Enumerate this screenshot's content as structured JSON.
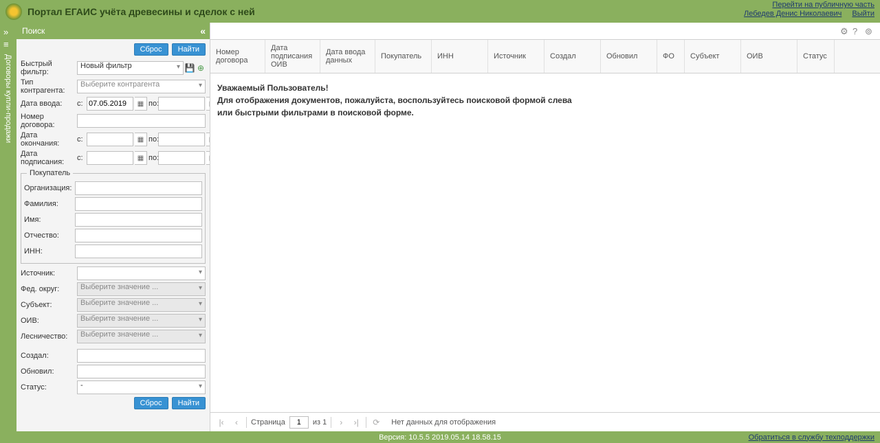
{
  "header": {
    "title": "Портал ЕГАИС учёта древесины и сделок с ней",
    "public_link": "Перейти на публичную часть",
    "user": "Лебедев Денис Николаевич",
    "logout": "Выйти"
  },
  "vtab": {
    "expand": "»",
    "icon": "≡",
    "label": "Договоры купли-продажи"
  },
  "sidebar": {
    "title": "Поиск",
    "collapse": "«",
    "reset": "Сброс",
    "find": "Найти",
    "quick_filter_label": "Быстрый фильтр:",
    "quick_filter_value": "Новый фильтр",
    "counterparty_type_label": "Тип контрагента:",
    "counterparty_type_value": "Выберите контрагента",
    "date_input_label": "Дата ввода:",
    "date_from": "с:",
    "date_to": "по:",
    "date_input_from": "07.05.2019",
    "date_input_to": "",
    "contract_num_label": "Номер договора:",
    "date_end_label": "Дата окончания:",
    "date_sign_label": "Дата подписания:",
    "buyer_legend": "Покупатель",
    "org_label": "Организация:",
    "surname_label": "Фамилия:",
    "name_label": "Имя:",
    "patronymic_label": "Отчество:",
    "inn_label": "ИНН:",
    "source_label": "Источник:",
    "fed_district_label": "Фед. округ:",
    "subject_label": "Субъект:",
    "oiv_label": "ОИВ:",
    "forestry_label": "Лесничество:",
    "select_placeholder": "Выберите значение ...",
    "created_label": "Создал:",
    "updated_label": "Обновил:",
    "status_label": "Статус:",
    "status_value": "-"
  },
  "table": {
    "columns": [
      "Номер договора",
      "Дата подписания ОИВ",
      "Дата ввода данных",
      "Покупатель",
      "ИНН",
      "Источник",
      "Создал",
      "Обновил",
      "ФО",
      "Субъект",
      "ОИВ",
      "Статус"
    ],
    "widths": [
      80,
      80,
      80,
      82,
      82,
      82,
      82,
      82,
      40,
      82,
      82,
      54
    ]
  },
  "message": {
    "line1": "Уважаемый Пользователь!",
    "line2": "Для отображения документов, пожалуйста, воспользуйтесь поисковой формой слева",
    "line3": "или быстрыми фильтрами в поисковой форме."
  },
  "pager": {
    "page_label": "Страница",
    "page": "1",
    "of": "из 1",
    "nodata": "Нет данных для отображения"
  },
  "footer": {
    "version": "Версия: 10.5.5    2019.05.14  18.58.15",
    "support": "Обратиться в службу техподдержки"
  }
}
